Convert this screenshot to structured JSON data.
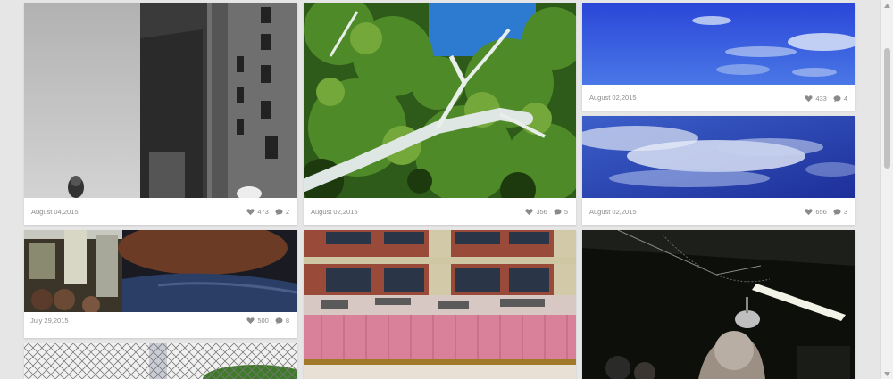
{
  "icons": {
    "likes": "heart-icon",
    "comments": "comment-icon"
  },
  "colors": {
    "background": "#e6e6e6",
    "card": "#ffffff",
    "meta_text": "#8a8a8a"
  },
  "photos": [
    {
      "date": "August 04,2015",
      "likes": "473",
      "comments": "2"
    },
    {
      "date": "August 02,2015",
      "likes": "356",
      "comments": "5"
    },
    {
      "date": "August 02,2015",
      "likes": "433",
      "comments": "4"
    },
    {
      "date": "August 02,2015",
      "likes": "656",
      "comments": "3"
    },
    {
      "date": "July 29,2015",
      "likes": "500",
      "comments": "8"
    }
  ]
}
